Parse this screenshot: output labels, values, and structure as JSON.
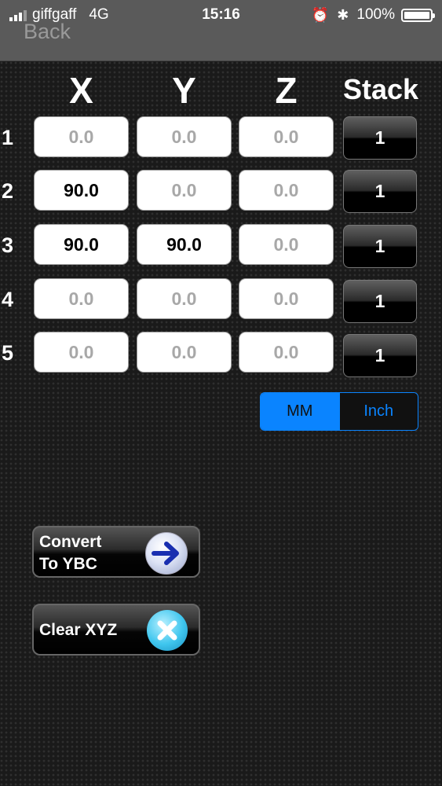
{
  "status_bar": {
    "carrier": "giffgaff",
    "network": "4G",
    "time": "15:16",
    "alarm_icon": "alarm-clock-icon",
    "bluetooth_icon": "bluetooth-icon",
    "battery_percent": "100%",
    "battery_level": 1.0
  },
  "nav": {
    "back_label": "Back"
  },
  "columns": {
    "x": "X",
    "y": "Y",
    "z": "Z",
    "stack": "Stack"
  },
  "rows": [
    {
      "num": "1",
      "x": "0.0",
      "y": "0.0",
      "z": "0.0",
      "stack": "1"
    },
    {
      "num": "2",
      "x": "90.0",
      "y": "0.0",
      "z": "0.0",
      "stack": "1"
    },
    {
      "num": "3",
      "x": "90.0",
      "y": "90.0",
      "z": "0.0",
      "stack": "1"
    },
    {
      "num": "4",
      "x": "0.0",
      "y": "0.0",
      "z": "0.0",
      "stack": "1"
    },
    {
      "num": "5",
      "x": "0.0",
      "y": "0.0",
      "z": "0.0",
      "stack": "1"
    }
  ],
  "units": {
    "options": [
      "MM",
      "Inch"
    ],
    "selected": "MM",
    "accent_color": "#0a84ff"
  },
  "buttons": {
    "convert_line1": "Convert",
    "convert_line2": "To YBC",
    "convert_icon": "right-arrow-icon",
    "clear_label": "Clear XYZ",
    "clear_icon": "close-icon"
  }
}
